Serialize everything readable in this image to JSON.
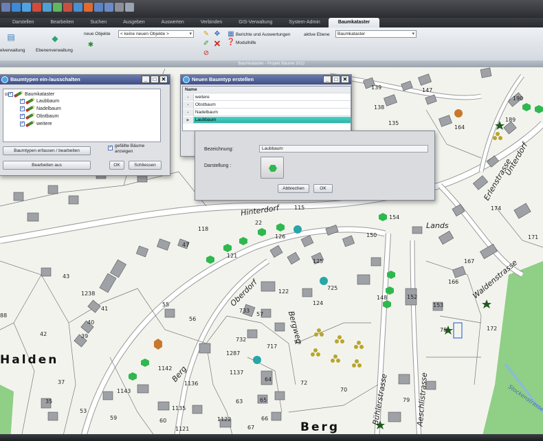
{
  "ribbon": {
    "tabs": [
      "Darstellen",
      "Bearbeiten",
      "Suchen",
      "Ausgeben",
      "Auswerten",
      "Verbinden",
      "GIS-Verwaltung",
      "System-Admin",
      "Baumkataster"
    ],
    "active_tab": "Baumkataster",
    "left_buttons": [
      "elverwaltung",
      "Ebenenverwaltung"
    ],
    "new_objects_label": "neue Objekte",
    "new_objects_value": "< keine neuen Objekte >",
    "reports_label": "Berichte und Auswertungen",
    "modulhilfe_label": "Modulhilfe",
    "active_layer_label": "aktive Ebene",
    "active_layer_value": "Baumkataster",
    "footer": "Baumkataster - Projekt Bäume 2012"
  },
  "dialog_tree": {
    "title": "Baumtypen ein-/ausschalten",
    "root": "Baumkataster",
    "items": [
      "Laubbaum",
      "Nadelbaum",
      "Obstbaum",
      "weitere"
    ],
    "btn_edit_types": "Baumtypen erfassen / bearbeiten",
    "checkbox_label": "gefällte Bäume anzeigen",
    "btn_edit_off": "Bearbeiten aus",
    "btn_ok": "OK",
    "btn_close": "Schliessen"
  },
  "dialog_list": {
    "title": "Neuen Baumtyp erstellen",
    "column": "Name",
    "rows": [
      "weitere",
      "Obstbaum",
      "Nadelbaum",
      "Laubbaum"
    ],
    "selected_row": "Laubbaum"
  },
  "dialog_detail": {
    "bezeichnung_label": "Bezeichnung:",
    "bezeichnung_value": "Laubbaum",
    "darstellung_label": "Darstellung :",
    "btn_cancel": "Abbrechen",
    "btn_ok": "OK"
  },
  "map": {
    "places": [
      "Halden",
      "Berg"
    ],
    "streets": [
      "Hinterdorf",
      "Oberdorf",
      "Berg",
      "Bergweg",
      "Bühlerstrasse",
      "Aeschlistrasse",
      "Erlenstrasse",
      "Lands",
      "Unterdorf",
      "Waldenstrasse",
      "Stockenstrasse"
    ],
    "parcels": [
      "139",
      "147",
      "138",
      "135",
      "190",
      "189",
      "164",
      "115",
      "118",
      "22",
      "126",
      "154",
      "150",
      "121",
      "125",
      "47",
      "174",
      "171",
      "167",
      "166",
      "43",
      "1238",
      "41",
      "40",
      "39",
      "42",
      "37",
      "725",
      "122",
      "124",
      "148",
      "152",
      "55",
      "733",
      "57",
      "56",
      "732",
      "717",
      "73",
      "1287",
      "1142",
      "1136",
      "1137",
      "1143",
      "64",
      "72",
      "70",
      "79",
      "63",
      "65",
      "1135",
      "59",
      "60",
      "1122",
      "1121",
      "66",
      "67",
      "53",
      "35",
      "88",
      "172",
      "78",
      "153"
    ],
    "tree_colors": {
      "laubbaum": "#2fb84f",
      "nadelbaum": "#1f5a1f",
      "obstbaum": "#b9a52a",
      "weitere_cyan": "#26a6a8",
      "weitere_orange": "#c8782a"
    }
  }
}
